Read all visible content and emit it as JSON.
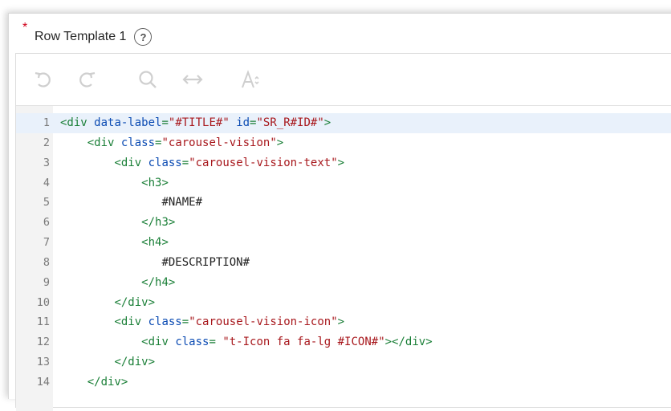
{
  "field": {
    "required_mark": "*",
    "label": "Row Template 1",
    "help_glyph": "?"
  },
  "toolbar": {
    "buttons": [
      {
        "name": "undo-icon",
        "enabled": false
      },
      {
        "name": "redo-icon",
        "enabled": false
      },
      {
        "name": "search-icon",
        "enabled": false
      },
      {
        "name": "transform-icon",
        "enabled": false
      },
      {
        "name": "font-size-icon",
        "enabled": false
      }
    ]
  },
  "editor": {
    "active_line": 1,
    "lines": [
      {
        "n": "1",
        "indent": "",
        "tokens": [
          [
            "tag",
            "<div "
          ],
          [
            "attr",
            "data-label"
          ],
          [
            "tag",
            "="
          ],
          [
            "str",
            "\"#TITLE#\""
          ],
          [
            "tag",
            " "
          ],
          [
            "attr",
            "id"
          ],
          [
            "tag",
            "="
          ],
          [
            "str",
            "\"SR_R#ID#\""
          ],
          [
            "tag",
            ">"
          ]
        ]
      },
      {
        "n": "2",
        "indent": "    ",
        "tokens": [
          [
            "tag",
            "<div "
          ],
          [
            "attr",
            "class"
          ],
          [
            "tag",
            "="
          ],
          [
            "str",
            "\"carousel-vision\""
          ],
          [
            "tag",
            ">"
          ]
        ]
      },
      {
        "n": "3",
        "indent": "        ",
        "tokens": [
          [
            "tag",
            "<div "
          ],
          [
            "attr",
            "class"
          ],
          [
            "tag",
            "="
          ],
          [
            "str",
            "\"carousel-vision-text\""
          ],
          [
            "tag",
            ">"
          ]
        ]
      },
      {
        "n": "4",
        "indent": "            ",
        "tokens": [
          [
            "tag",
            "<h3>"
          ]
        ]
      },
      {
        "n": "5",
        "indent": "               ",
        "tokens": [
          [
            "txt",
            "#NAME#"
          ]
        ]
      },
      {
        "n": "6",
        "indent": "            ",
        "tokens": [
          [
            "tag",
            "</h3>"
          ]
        ]
      },
      {
        "n": "7",
        "indent": "            ",
        "tokens": [
          [
            "tag",
            "<h4>"
          ]
        ]
      },
      {
        "n": "8",
        "indent": "               ",
        "tokens": [
          [
            "txt",
            "#DESCRIPTION#"
          ]
        ]
      },
      {
        "n": "9",
        "indent": "            ",
        "tokens": [
          [
            "tag",
            "</h4>"
          ]
        ]
      },
      {
        "n": "10",
        "indent": "        ",
        "tokens": [
          [
            "tag",
            "</div>"
          ]
        ]
      },
      {
        "n": "11",
        "indent": "        ",
        "tokens": [
          [
            "tag",
            "<div "
          ],
          [
            "attr",
            "class"
          ],
          [
            "tag",
            "="
          ],
          [
            "str",
            "\"carousel-vision-icon\""
          ],
          [
            "tag",
            ">"
          ]
        ]
      },
      {
        "n": "12",
        "indent": "            ",
        "tokens": [
          [
            "tag",
            "<div "
          ],
          [
            "attr",
            "class"
          ],
          [
            "tag",
            "= "
          ],
          [
            "str",
            "\"t-Icon fa fa-lg #ICON#\""
          ],
          [
            "tag",
            "></div>"
          ]
        ]
      },
      {
        "n": "13",
        "indent": "        ",
        "tokens": [
          [
            "tag",
            "</div>"
          ]
        ]
      },
      {
        "n": "14",
        "indent": "    ",
        "tokens": [
          [
            "tag",
            "</div>"
          ]
        ]
      }
    ]
  },
  "colors": {
    "tag": "#1a7f37",
    "attribute": "#0b4bb3",
    "string": "#a8181d",
    "required": "#d0021b",
    "active_line": "#e9f1fb",
    "gutter": "#f3f3f3"
  }
}
